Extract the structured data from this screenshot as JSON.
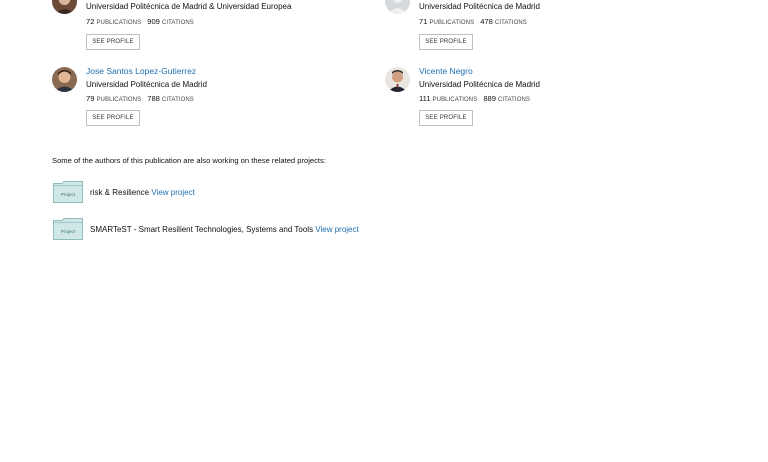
{
  "authors": [
    {
      "name": "",
      "affiliation": "Universidad Politécnica de Madrid & Universidad Europea",
      "publications": "72",
      "citations": "909",
      "publications_label": "PUBLICATIONS",
      "citations_label": "CITATIONS",
      "button": "SEE PROFILE",
      "avatar": "photo"
    },
    {
      "name": "",
      "affiliation": "Universidad Politécnica de Madrid",
      "publications": "71",
      "citations": "478",
      "publications_label": "PUBLICATIONS",
      "citations_label": "CITATIONS",
      "button": "SEE PROFILE",
      "avatar": "placeholder"
    },
    {
      "name": "Jose Santos Lopez-Gutierrez",
      "affiliation": "Universidad Politécnica de Madrid",
      "publications": "79",
      "citations": "788",
      "publications_label": "PUBLICATIONS",
      "citations_label": "CITATIONS",
      "button": "SEE PROFILE",
      "avatar": "photo"
    },
    {
      "name": "Vicente Negro",
      "affiliation": "Universidad Politécnica de Madrid",
      "publications": "111",
      "citations": "889",
      "publications_label": "PUBLICATIONS",
      "citations_label": "CITATIONS",
      "button": "SEE PROFILE",
      "avatar": "photo"
    }
  ],
  "related_heading": "Some of the authors of this publication are also working on these related projects:",
  "projects": [
    {
      "badge": "Project",
      "title": "risk & Resilience",
      "link": "View project",
      "icon": "project-folder-icon"
    },
    {
      "badge": "Project",
      "title": "SMARTeST - Smart Resilient Technologies, Systems and Tools",
      "link": "View project",
      "icon": "project-folder-icon"
    }
  ],
  "colors": {
    "link": "#1f6fb2",
    "folder": "#cfe7e6",
    "folder_border": "#8fbdbb"
  }
}
